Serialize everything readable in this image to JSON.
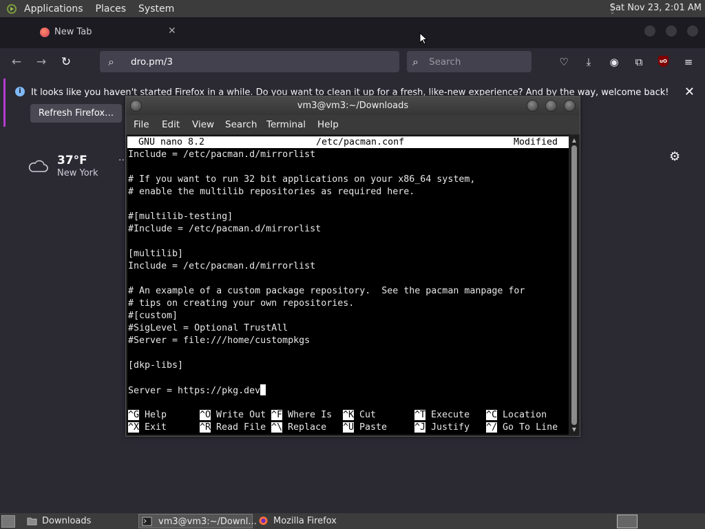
{
  "top_panel": {
    "menus": [
      "Applications",
      "Places",
      "System"
    ],
    "clock": "Sat Nov 23,  2:01 AM"
  },
  "firefox": {
    "tab": {
      "title": "New Tab",
      "close": "✕"
    },
    "url": "dro.pm/3",
    "search_placeholder": "Search",
    "notification": {
      "message": "It looks like you haven't started Firefox in a while. Do you want to clean it up for a fresh, like-new experience? And by the way, welcome back!",
      "button": "Refresh Firefox…",
      "close": "✕"
    },
    "weather": {
      "temp": "37°F",
      "city": "New York",
      "more": "···"
    },
    "ublock_badge": "uO"
  },
  "terminal": {
    "title": "vm3@vm3:~/Downloads",
    "menu": [
      "File",
      "Edit",
      "View",
      "Search",
      "Terminal",
      "Help"
    ],
    "nano_header": {
      "version": "GNU nano 8.2",
      "file": "/etc/pacman.conf",
      "state": "Modified"
    },
    "lines": [
      "Include = /etc/pacman.d/mirrorlist",
      "",
      "# If you want to run 32 bit applications on your x86_64 system,",
      "# enable the multilib repositories as required here.",
      "",
      "#[multilib-testing]",
      "#Include = /etc/pacman.d/mirrorlist",
      "",
      "[multilib]",
      "Include = /etc/pacman.d/mirrorlist",
      "",
      "# An example of a custom package repository.  See the pacman manpage for",
      "# tips on creating your own repositories.",
      "#[custom]",
      "#SigLevel = Optional TrustAll",
      "#Server = file:///home/custompkgs",
      "",
      "[dkp-libs]",
      "",
      "Server = https://pkg.dev"
    ],
    "shortcuts_row1": [
      {
        "key": "^G",
        "label": "Help"
      },
      {
        "key": "^O",
        "label": "Write Out"
      },
      {
        "key": "^F",
        "label": "Where Is"
      },
      {
        "key": "^K",
        "label": "Cut"
      },
      {
        "key": "^T",
        "label": "Execute"
      },
      {
        "key": "^C",
        "label": "Location"
      }
    ],
    "shortcuts_row2": [
      {
        "key": "^X",
        "label": "Exit"
      },
      {
        "key": "^R",
        "label": "Read File"
      },
      {
        "key": "^\\",
        "label": "Replace"
      },
      {
        "key": "^U",
        "label": "Paste"
      },
      {
        "key": "^J",
        "label": "Justify"
      },
      {
        "key": "^/",
        "label": "Go To Line"
      }
    ]
  },
  "taskbar": {
    "tasks": [
      {
        "label": "Downloads",
        "icon": "folder-icon"
      },
      {
        "label": "vm3@vm3:~/Downl...",
        "icon": "terminal-icon"
      },
      {
        "label": "Mozilla Firefox",
        "icon": "firefox-icon"
      }
    ]
  }
}
